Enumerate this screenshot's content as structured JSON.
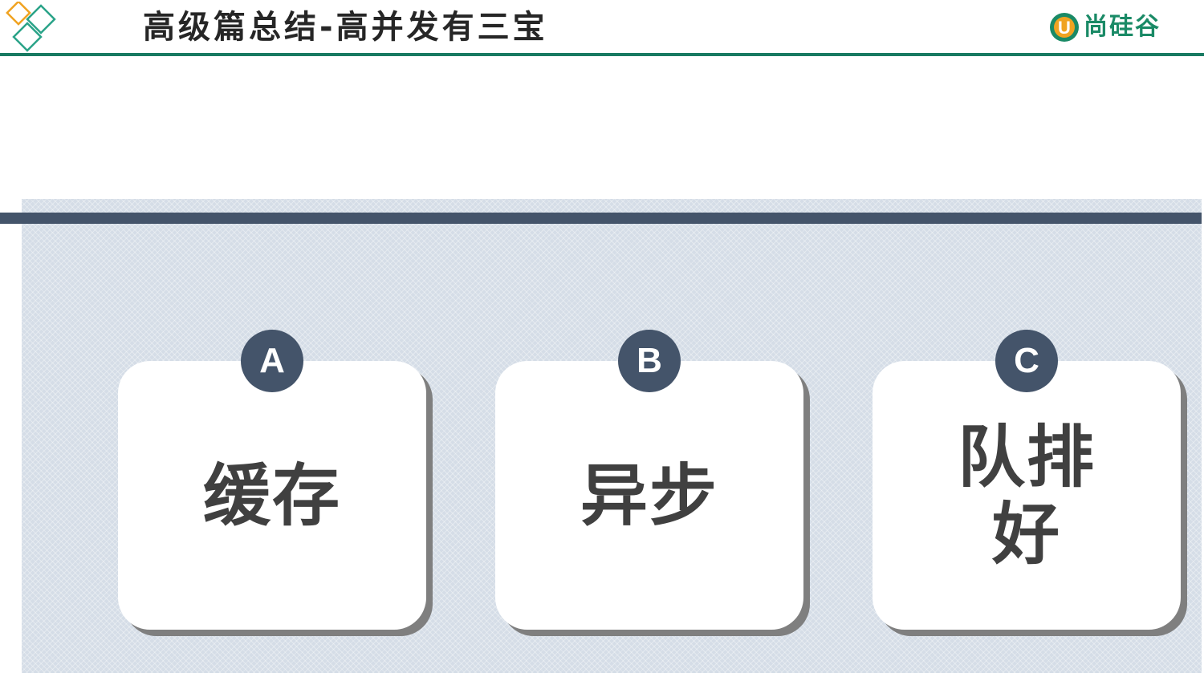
{
  "header": {
    "title": "高级篇总结-高并发有三宝",
    "brand_name": "尚硅谷",
    "brand_mark_letter": "U",
    "brand_color": "#1a8a66",
    "rule_color": "#187a62"
  },
  "panel": {
    "background": "#d5dde7",
    "bar_color": "#44546a"
  },
  "cards": [
    {
      "badge": "A",
      "label": "缓存"
    },
    {
      "badge": "B",
      "label": "异步"
    },
    {
      "badge": "C",
      "label": "队排好"
    }
  ]
}
